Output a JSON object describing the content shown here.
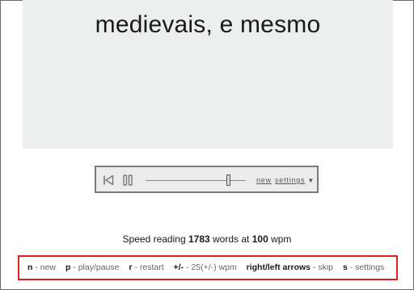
{
  "reader": {
    "current_word": "medievais, e mesmo"
  },
  "controls": {
    "prev_icon": "skip-back-icon",
    "pause_icon": "pause-icon",
    "speed_slider_fraction": 0.86,
    "new_label": "new",
    "settings_label": "settings",
    "settings_caret": "▼"
  },
  "stats": {
    "prefix": "Speed reading",
    "word_count": "1783",
    "middle": "words at",
    "wpm_value": "100",
    "suffix": "wpm"
  },
  "shortcuts": [
    {
      "key": "n",
      "desc": "- new"
    },
    {
      "key": "p",
      "desc": "- play/pause"
    },
    {
      "key": "r",
      "desc": "- restart"
    },
    {
      "key": "+/-",
      "desc": "- 25(+/-) wpm"
    },
    {
      "key": "right/left arrows",
      "desc": "- skip"
    },
    {
      "key": "s",
      "desc": "- settings"
    }
  ],
  "colors": {
    "pane_background": "#eceeed",
    "shortcuts_border": "#e0201d"
  }
}
